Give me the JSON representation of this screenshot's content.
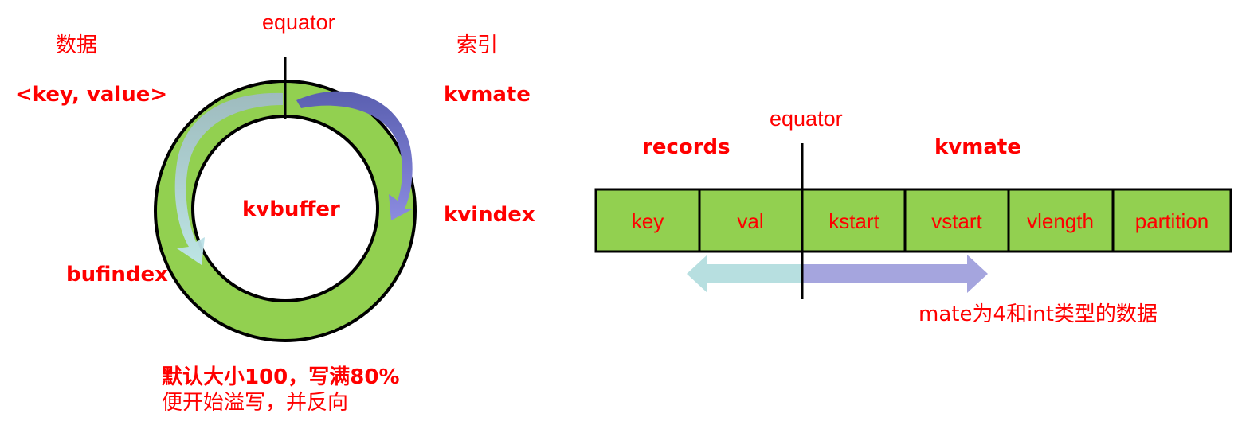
{
  "ring": {
    "equator_label": "equator",
    "data_label": "数据",
    "index_label": "索引",
    "kv_label": "<key, value>",
    "kvmate_label": "kvmate",
    "kvindex_label": "kvindex",
    "bufindex_label": "bufindex",
    "center_label": "kvbuffer",
    "note_line1": "默认大小100，写满80%",
    "note_line2": "便开始溢写，并反向"
  },
  "strip": {
    "equator_label": "equator",
    "records_label": "records",
    "kvmate_label": "kvmate",
    "cells": [
      "key",
      "val",
      "kstart",
      "vstart",
      "vlength",
      "partition"
    ],
    "mate_note": "mate为4和int类型的数据"
  },
  "colors": {
    "accent_text": "#ff0000",
    "buffer_fill": "#92d050",
    "left_arrow": "#b7dfe0",
    "right_arrow": "#8f8fd8",
    "border": "#000000"
  }
}
